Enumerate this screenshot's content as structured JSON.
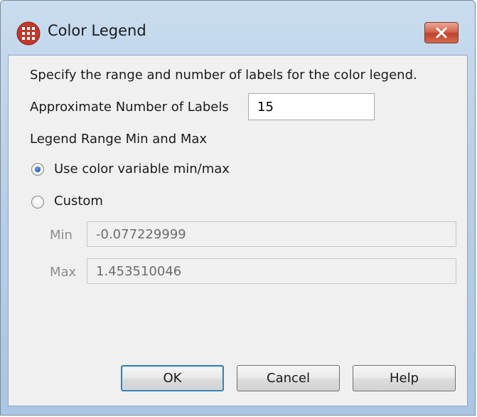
{
  "window": {
    "title": "Color Legend",
    "close_icon": "close-icon"
  },
  "dialog": {
    "description": "Specify the range and number of labels for the color legend.",
    "num_labels_label": "Approximate Number of Labels",
    "num_labels_value": "15",
    "range_heading": "Legend Range Min and Max",
    "option_use_minmax": "Use color variable min/max",
    "option_custom": "Custom",
    "selected_option": "use_minmax",
    "min_label": "Min",
    "min_value": "-0.077229999",
    "max_label": "Max",
    "max_value": "1.453510046"
  },
  "buttons": {
    "ok": "OK",
    "cancel": "Cancel",
    "help": "Help"
  },
  "colors": {
    "app_icon": "#c0392b",
    "radio_selected": "#1e5bbd",
    "default_button_border": "#3c7fb1"
  }
}
